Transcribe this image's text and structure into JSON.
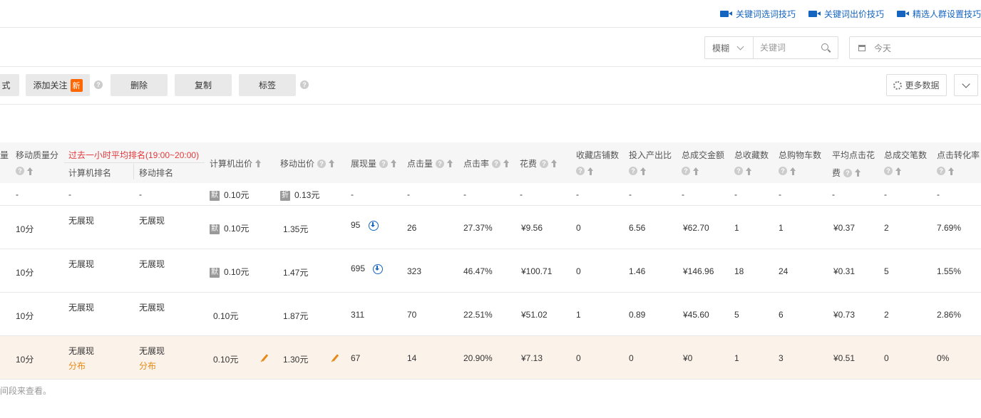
{
  "tips": [
    "关键词选词技巧",
    "关键词出价技巧",
    "精选人群设置技巧"
  ],
  "filter": {
    "match_mode": "模糊",
    "keyword_placeholder": "关键词",
    "date": "今天"
  },
  "toolbar": {
    "partial_label": "式",
    "add_follow": "添加关注",
    "new_badge": "新",
    "delete": "删除",
    "copy": "复制",
    "tag": "标签",
    "more_data": "更多数据"
  },
  "header": {
    "partial": "量",
    "mobile_quality": "移动质量分",
    "rank_group": "过去一小时平均排名(19:00~20:00)",
    "pc_rank": "计算机排名",
    "mobile_rank": "移动排名",
    "pc_bid": "计算机出价",
    "mobile_bid": "移动出价",
    "impressions": "展现量",
    "clicks": "点击量",
    "ctr": "点击率",
    "cost": "花费",
    "fav_shop": "收藏店铺数",
    "roi": "投入产出比",
    "total_gmv": "总成交金额",
    "total_fav": "总收藏数",
    "total_cart": "总购物车数",
    "avg_cpc_line1": "平均点击花",
    "avg_cpc_line2": "费",
    "total_orders": "总成交笔数",
    "cvr": "点击转化率"
  },
  "summary": {
    "dash": "-",
    "pc_tag": "默",
    "pc_bid": "0.10元",
    "mobile_tag": "折",
    "mobile_bid": "0.13元"
  },
  "rows": [
    {
      "quality": "10分",
      "pc_rank": "无展现",
      "mobile_rank": "无展现",
      "pc_tag": "默",
      "pc_bid": "0.10元",
      "mobile_bid": "1.35元",
      "impressions": "95",
      "clicks": "26",
      "ctr": "27.37%",
      "cost": "¥9.56",
      "fav_shop": "0",
      "roi": "6.56",
      "gmv": "¥62.70",
      "fav": "1",
      "cart": "1",
      "cpc": "¥0.37",
      "orders": "2",
      "cvr": "7.69%"
    },
    {
      "quality": "10分",
      "pc_rank": "无展现",
      "mobile_rank": "无展现",
      "pc_tag": "默",
      "pc_bid": "0.10元",
      "mobile_bid": "1.47元",
      "impressions": "695",
      "clicks": "323",
      "ctr": "46.47%",
      "cost": "¥100.71",
      "fav_shop": "0",
      "roi": "1.46",
      "gmv": "¥146.96",
      "fav": "18",
      "cart": "24",
      "cpc": "¥0.31",
      "orders": "5",
      "cvr": "1.55%"
    },
    {
      "quality": "10分",
      "pc_rank": "无展现",
      "mobile_rank": "无展现",
      "pc_bid": "0.10元",
      "mobile_bid": "1.87元",
      "impressions": "311",
      "clicks": "70",
      "ctr": "22.51%",
      "cost": "¥51.02",
      "fav_shop": "1",
      "roi": "0.89",
      "gmv": "¥45.60",
      "fav": "5",
      "cart": "6",
      "cpc": "¥0.73",
      "orders": "2",
      "cvr": "2.86%"
    },
    {
      "quality": "10分",
      "pc_rank": "无展现",
      "mobile_rank": "无展现",
      "pc_dist": "分布",
      "mobile_dist": "分布",
      "pc_bid": "0.10元",
      "mobile_bid": "1.30元",
      "impressions": "67",
      "clicks": "14",
      "ctr": "20.90%",
      "cost": "¥7.13",
      "fav_shop": "0",
      "roi": "0",
      "gmv": "¥0",
      "fav": "1",
      "cart": "3",
      "cpc": "¥0.51",
      "orders": "0",
      "cvr": "0%"
    }
  ],
  "footnote": "间段来查看。",
  "colors": {
    "link": "#1565c0",
    "accent": "#e58a16",
    "red": "#e4393c",
    "badge": "#ff6600"
  },
  "icons": [
    "video-camera-icon",
    "chevron-down-icon",
    "search-icon",
    "calendar-icon",
    "help-icon",
    "gear-icon",
    "sort-up-icon",
    "download-icon",
    "edit-icon"
  ]
}
